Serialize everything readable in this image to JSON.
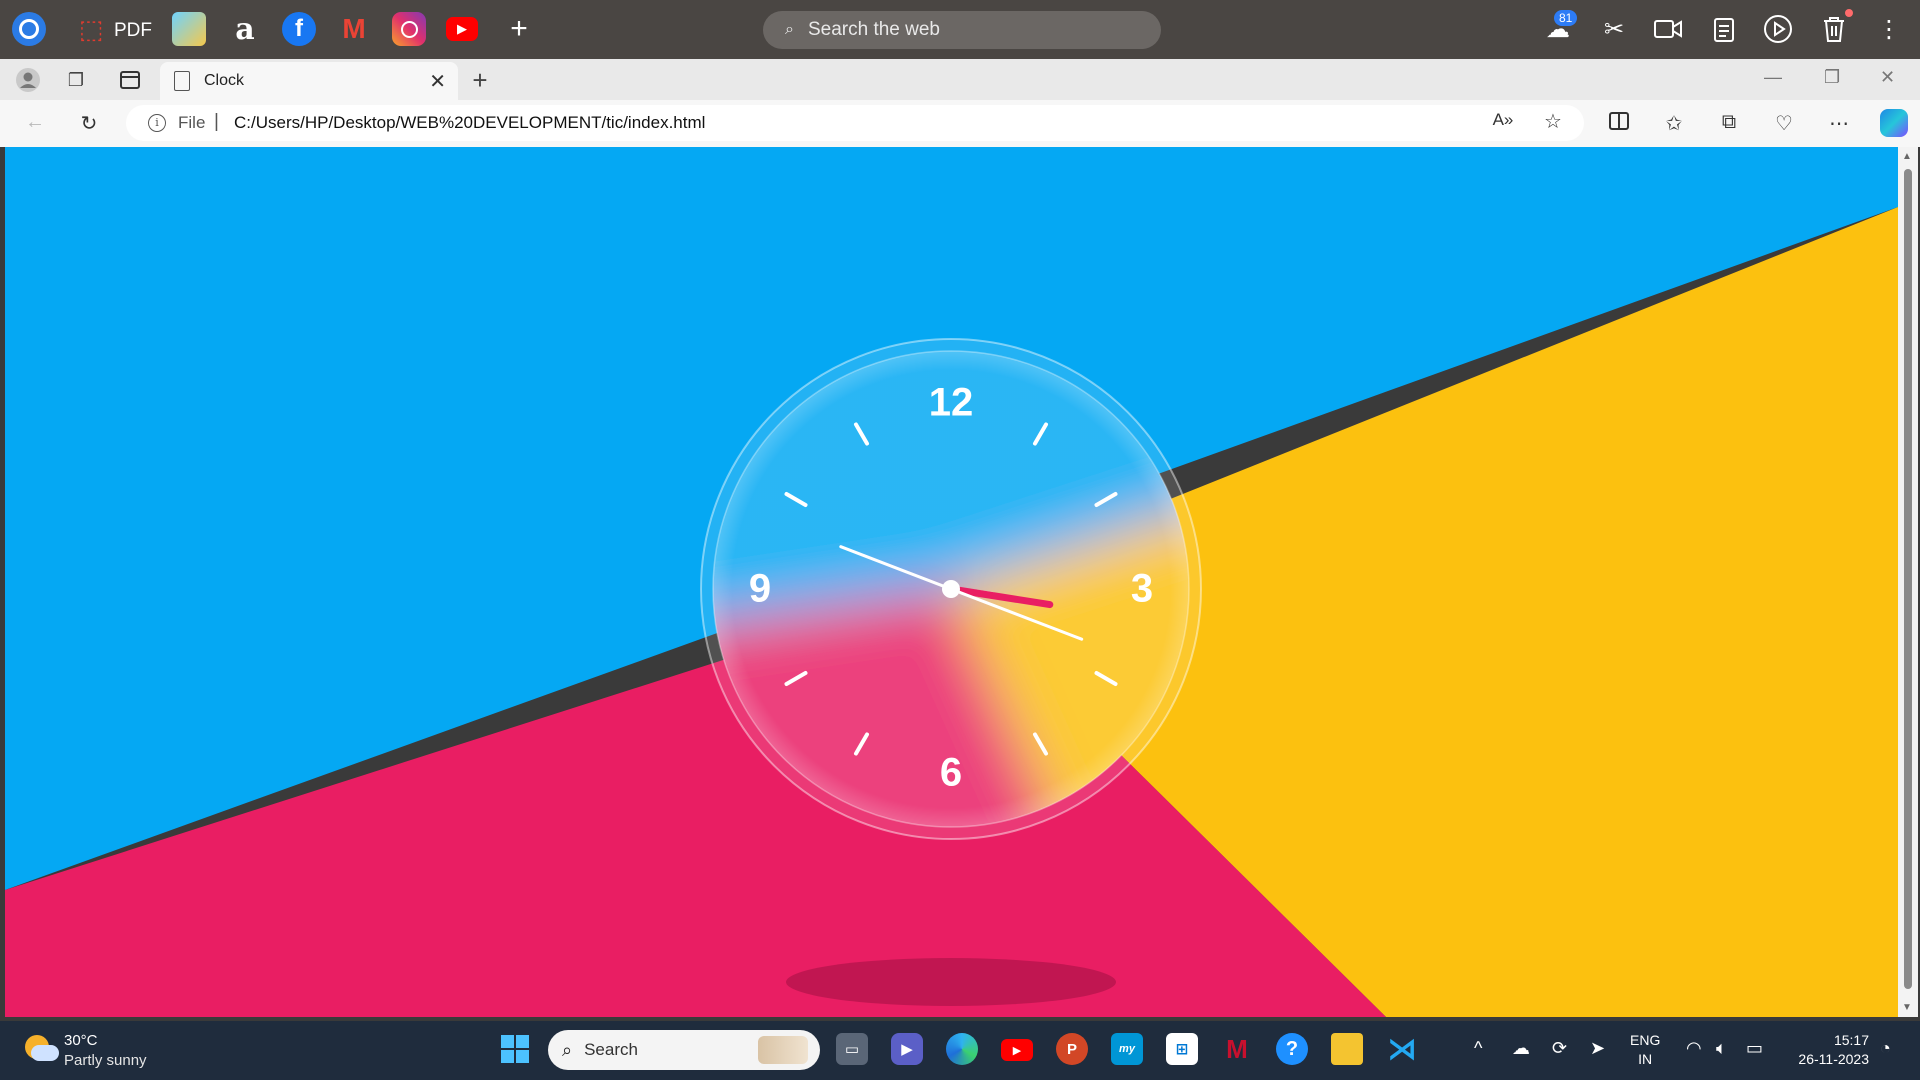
{
  "launcher": {
    "pdf_label": "PDF",
    "search_placeholder": "Search the web",
    "cloud_badge": "81",
    "add_symbol": "+"
  },
  "tab": {
    "title": "Clock"
  },
  "address": {
    "scheme": "File",
    "separator": "|",
    "path": "C:/Users/HP/Desktop/WEB%20DEVELOPMENT/tic/index.html"
  },
  "clock_page": {
    "numerals": [
      "12",
      "3",
      "6",
      "9"
    ],
    "background_colors": {
      "blue": "#05a8f3",
      "yellow": "#fcc10f",
      "pink": "#e91e63"
    },
    "time": {
      "hour": 15,
      "minute": 16.5,
      "second": 48.5
    }
  },
  "taskbar": {
    "weather_temp": "30°C",
    "weather_condition": "Partly sunny",
    "search_placeholder": "Search",
    "language_top": "ENG",
    "language_bottom": "IN",
    "time": "15:17",
    "date": "26-11-2023"
  }
}
